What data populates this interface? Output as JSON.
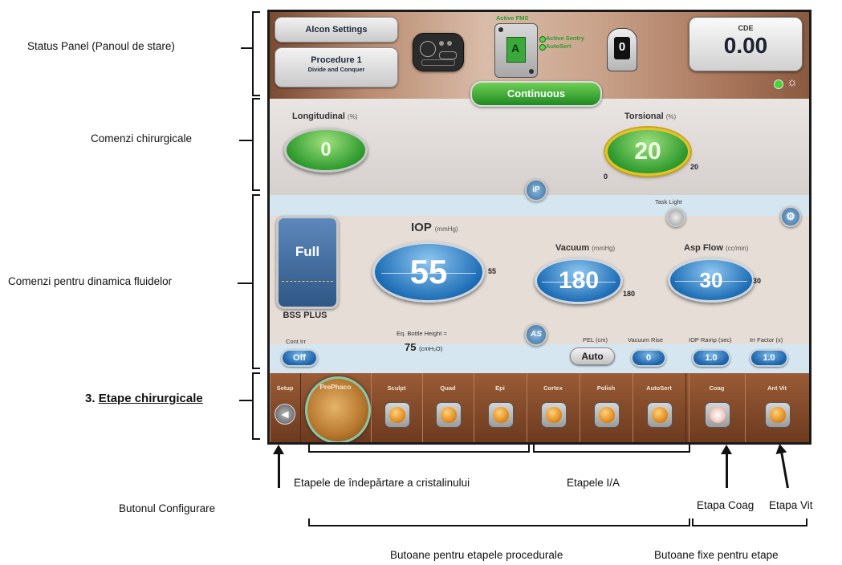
{
  "annotations": {
    "status_panel": "Status Panel (Panoul de stare)",
    "surgical_controls": "Comenzi chirurgicale",
    "fluidics_controls": "Comenzi pentru dinamica fluidelor",
    "surgical_steps_num": "3.",
    "surgical_steps": "Etape chirurgicale",
    "lens_removal_steps": "Etapele de îndepărtare a cristalinului",
    "ia_steps": "Etapele I/A",
    "setup_button": "Butonul Configurare",
    "coag_step": "Etapa Coag",
    "vit_step": "Etapa Vit",
    "procedural_buttons": "Butoane pentru etapele procedurale",
    "fixed_buttons": "Butoane fixe pentru etape"
  },
  "status": {
    "settings": "Alcon Settings",
    "procedure_title": "Procedure 1",
    "procedure_subtitle": "Divide and Conquer",
    "active_fms": "Active FMS",
    "fms_letter": "A",
    "active_sentry": "Active Sentry",
    "autosert": "AutoSert",
    "footswitch_value": "0",
    "cde_label": "CDE",
    "cde_value": "0.00",
    "mode": "Continuous"
  },
  "surgical": {
    "longitudinal_label": "Longitudinal",
    "longitudinal_unit": "(%)",
    "longitudinal_value": "0",
    "torsional_label": "Torsional",
    "torsional_unit": "(%)",
    "torsional_value": "20",
    "torsional_min": "0",
    "torsional_max": "20",
    "ip_icon_text": "iP"
  },
  "fluidics": {
    "task_light": "Task Light",
    "bottle_status": "Full",
    "bottle_name": "BSS PLUS",
    "iop_label": "IOP",
    "iop_unit": "(mmHg)",
    "iop_value": "55",
    "iop_limit": "55",
    "vacuum_label": "Vacuum",
    "vacuum_unit": "(mmHg)",
    "vacuum_value": "180",
    "vacuum_limit": "180",
    "aspflow_label": "Asp Flow",
    "aspflow_unit": "(cc/min)",
    "aspflow_value": "30",
    "aspflow_limit": "30",
    "bottle_height_label": "Eq. Bottle Height =",
    "bottle_height_value": "75",
    "bottle_height_unit": "(cmH₂O)",
    "as_icon_text": "AS",
    "cont_irr_label": "Cont Irr",
    "cont_irr_value": "Off",
    "pel_label": "PEL (cm)",
    "pel_value": "Auto",
    "vacuum_rise_label": "Vacuum Rise",
    "vacuum_rise_value": "0",
    "iop_ramp_label": "IOP Ramp (sec)",
    "iop_ramp_value": "1.0",
    "irr_factor_label": "Irr Factor (x)",
    "irr_factor_value": "1.0"
  },
  "steps": {
    "setup": "Setup",
    "items": [
      "PrePhaco",
      "Sculpt",
      "Quad",
      "Epi",
      "Cortex",
      "Polish",
      "AutoSert",
      "Coag",
      "Ant Vit"
    ]
  }
}
